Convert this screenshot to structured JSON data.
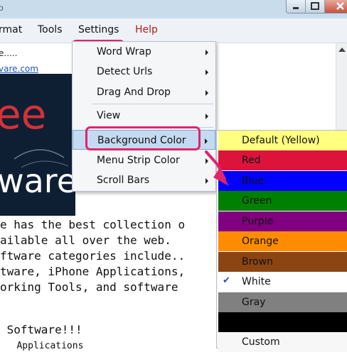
{
  "window": {
    "title_fragment": "o"
  },
  "menubar": {
    "items": [
      {
        "key": "format",
        "label": "rmat"
      },
      {
        "key": "tools",
        "label": "Tools"
      },
      {
        "key": "settings",
        "label": "Settings"
      },
      {
        "key": "help",
        "label": "Help"
      }
    ]
  },
  "document": {
    "line1": "e.....",
    "link": "vare.com",
    "mono_lines": [
      "e has the best collection o",
      "ailable all over the web.",
      "ftware categories include..",
      "tware, iPhone Applications,",
      "orking Tools, and software",
      "",
      " Software!!!",
      "   Applications"
    ],
    "logo_top": "ee",
    "logo_bottom": "ware"
  },
  "settings_menu": {
    "items": [
      {
        "label": "Word Wrap",
        "has_submenu": true
      },
      {
        "label": "Detect Urls",
        "has_submenu": true
      },
      {
        "label": "Drag And Drop",
        "has_submenu": true
      },
      {
        "label": "View",
        "has_submenu": true
      },
      {
        "label": "Background Color",
        "has_submenu": true,
        "active": true
      },
      {
        "label": "Menu Strip Color",
        "has_submenu": true
      },
      {
        "label": "Scroll Bars",
        "has_submenu": true
      }
    ]
  },
  "background_color_menu": {
    "items": [
      {
        "label": "Default (Yellow)",
        "color": "#ffff80"
      },
      {
        "label": "Red",
        "color": "#dc143c"
      },
      {
        "label": "Blue",
        "color": "#0000ff"
      },
      {
        "label": "Green",
        "color": "#008000"
      },
      {
        "label": "Purple",
        "color": "#800080"
      },
      {
        "label": "Orange",
        "color": "#ff8c00"
      },
      {
        "label": "Brown",
        "color": "#8b4513"
      },
      {
        "label": "White",
        "color": "#ffffff",
        "checked": true
      },
      {
        "label": "Gray",
        "color": "#808080"
      },
      {
        "label": "",
        "color": "#000000"
      },
      {
        "label": "Custom",
        "color": "#f7f7f7"
      }
    ]
  },
  "colors": {
    "highlight_outline": "#e0246e",
    "help_text": "#b41a1a"
  }
}
